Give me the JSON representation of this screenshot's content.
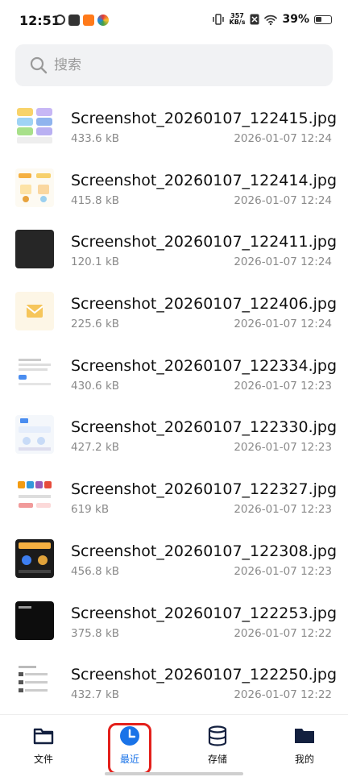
{
  "status": {
    "time": "12:51",
    "speed_top": "357",
    "speed_unit": "KB/s",
    "battery": "39%"
  },
  "search": {
    "placeholder": "搜索"
  },
  "files": [
    {
      "name": "Screenshot_20260107_122415.jpg",
      "size": "433.6 kB",
      "date": "2026-01-07 12:24"
    },
    {
      "name": "Screenshot_20260107_122414.jpg",
      "size": "415.8 kB",
      "date": "2026-01-07 12:24"
    },
    {
      "name": "Screenshot_20260107_122411.jpg",
      "size": "120.1 kB",
      "date": "2026-01-07 12:24"
    },
    {
      "name": "Screenshot_20260107_122406.jpg",
      "size": "225.6 kB",
      "date": "2026-01-07 12:24"
    },
    {
      "name": "Screenshot_20260107_122334.jpg",
      "size": "430.6 kB",
      "date": "2026-01-07 12:23"
    },
    {
      "name": "Screenshot_20260107_122330.jpg",
      "size": "427.2 kB",
      "date": "2026-01-07 12:23"
    },
    {
      "name": "Screenshot_20260107_122327.jpg",
      "size": "619 kB",
      "date": "2026-01-07 12:23"
    },
    {
      "name": "Screenshot_20260107_122308.jpg",
      "size": "456.8 kB",
      "date": "2026-01-07 12:23"
    },
    {
      "name": "Screenshot_20260107_122253.jpg",
      "size": "375.8 kB",
      "date": "2026-01-07 12:22"
    },
    {
      "name": "Screenshot_20260107_122250.jpg",
      "size": "432.7 kB",
      "date": "2026-01-07 12:22"
    }
  ],
  "nav": {
    "files": "文件",
    "recent": "最近",
    "storage": "存储",
    "mine": "我的"
  },
  "colors": {
    "accent": "#1a73e8",
    "highlight": "#e3201b"
  }
}
